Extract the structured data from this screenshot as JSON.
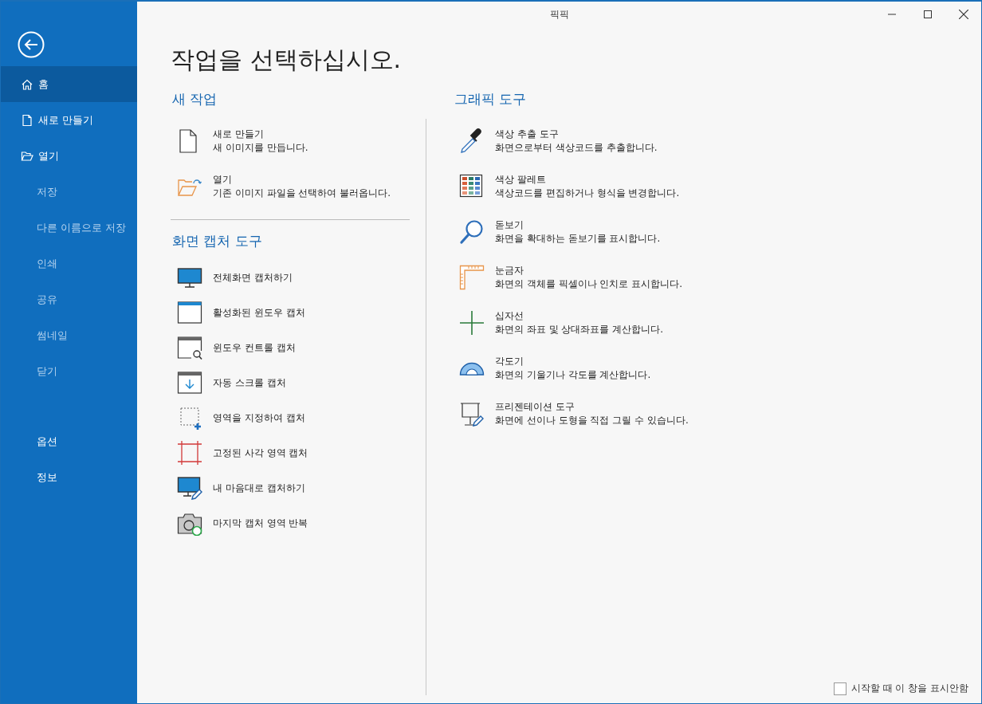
{
  "window": {
    "title": "픽픽"
  },
  "sidebar": {
    "items": [
      {
        "label": "홈",
        "selected": true,
        "disabled": false
      },
      {
        "label": "새로 만들기",
        "selected": false,
        "disabled": false
      },
      {
        "label": "열기",
        "selected": false,
        "disabled": false
      },
      {
        "label": "저장",
        "selected": false,
        "disabled": true
      },
      {
        "label": "다른 이름으로 저장",
        "selected": false,
        "disabled": true
      },
      {
        "label": "인쇄",
        "selected": false,
        "disabled": true
      },
      {
        "label": "공유",
        "selected": false,
        "disabled": true
      },
      {
        "label": "썸네일",
        "selected": false,
        "disabled": true
      },
      {
        "label": "닫기",
        "selected": false,
        "disabled": true
      }
    ],
    "footer_items": [
      {
        "label": "옵션",
        "selected": false,
        "disabled": false
      },
      {
        "label": "정보",
        "selected": false,
        "disabled": false
      }
    ]
  },
  "heading": "작업을 선택하십시오.",
  "new_task": {
    "title": "새 작업",
    "items": [
      {
        "name": "새로 만들기",
        "description": "새 이미지를 만듭니다."
      },
      {
        "name": "열기",
        "description": "기존 이미지 파일을 선택하여 불러옵니다."
      }
    ]
  },
  "capture_tools": {
    "title": "화면 캡처 도구",
    "items": [
      {
        "name": "전체화면 캡처하기"
      },
      {
        "name": "활성화된 윈도우 캡처"
      },
      {
        "name": "윈도우 컨트롤 캡처"
      },
      {
        "name": "자동 스크롤 캡처"
      },
      {
        "name": "영역을 지정하여 캡처"
      },
      {
        "name": "고정된 사각 영역 캡처"
      },
      {
        "name": "내 마음대로 캡처하기"
      },
      {
        "name": "마지막 캡처 영역 반복"
      }
    ]
  },
  "graphic_tools": {
    "title": "그래픽 도구",
    "items": [
      {
        "name": "색상 추출 도구",
        "description": "화면으로부터 색상코드를 추출합니다."
      },
      {
        "name": "색상 팔레트",
        "description": "색상코드를 편집하거나 형식을 변경합니다."
      },
      {
        "name": "돋보기",
        "description": "화면을 확대하는 돋보기를 표시합니다."
      },
      {
        "name": "눈금자",
        "description": "화면의 객체를 픽셀이나 인치로 표시합니다."
      },
      {
        "name": "십자선",
        "description": "화면의 좌표 및 상대좌표를 계산합니다."
      },
      {
        "name": "각도기",
        "description": "화면의 기울기나 각도를 계산합니다."
      },
      {
        "name": "프리젠테이션 도구",
        "description": "화면에 선이나 도형을 직접 그릴 수 있습니다."
      }
    ]
  },
  "show_on_start": {
    "label": "시작할 때 이 창을 표시안함",
    "checked": false
  }
}
